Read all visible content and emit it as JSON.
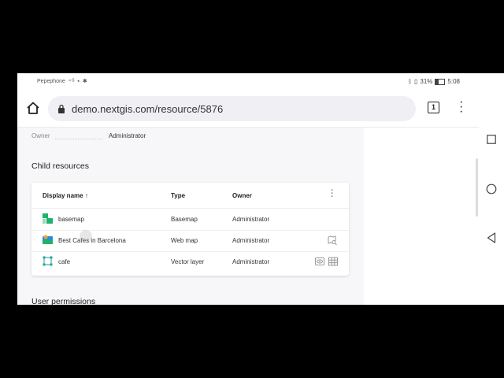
{
  "statusbar": {
    "carrier": "Pepephone",
    "battery": "31%",
    "time": "5:08"
  },
  "browser": {
    "url": "demo.nextgis.com/resource/5876",
    "tab_count": "1"
  },
  "page": {
    "owner_label": "Owner",
    "owner_value": "Administrator",
    "child_resources_title": "Child resources",
    "user_permissions_title": "User permissions"
  },
  "table": {
    "columns": {
      "name": "Display name",
      "type": "Type",
      "owner": "Owner"
    },
    "sort_indicator": "↑",
    "rows": [
      {
        "name": "basemap",
        "type": "Basemap",
        "owner": "Administrator",
        "icon": "basemap-icon"
      },
      {
        "name": "Best Cafes in Barcelona",
        "type": "Web map",
        "owner": "Administrator",
        "icon": "webmap-icon",
        "action": "open-map-icon"
      },
      {
        "name": "cafe",
        "type": "Vector layer",
        "owner": "Administrator",
        "icon": "vector-layer-icon",
        "actions": [
          "preview-icon",
          "table-icon"
        ]
      }
    ]
  },
  "colors": {
    "accent_green": "#1fb36b",
    "accent_blue": "#2c8cd6",
    "page_bg": "#f7f7f9"
  }
}
